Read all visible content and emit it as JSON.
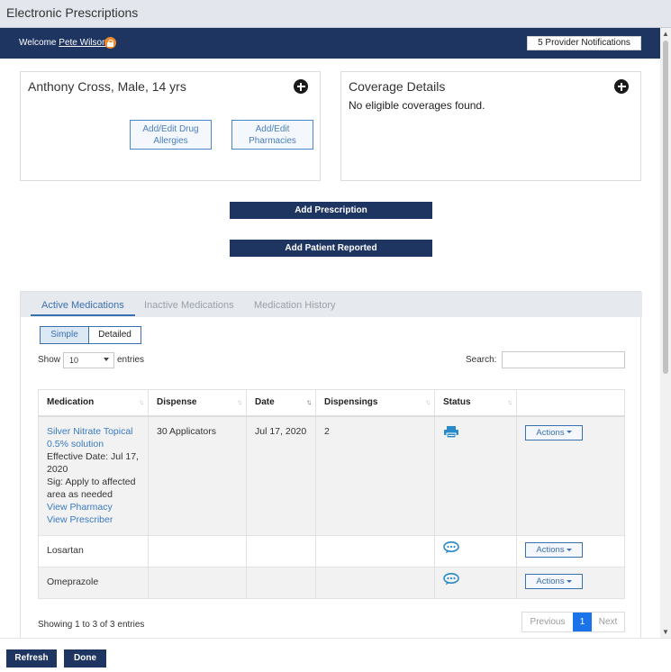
{
  "window": {
    "title": "Electronic Prescriptions"
  },
  "header": {
    "welcome_prefix": "Welcome",
    "user_name": "Pete Wilson",
    "notifications_label": "5 Provider Notifications"
  },
  "patient": {
    "summary": "Anthony Cross, Male, 14 yrs",
    "allergies_button": "Add/Edit Drug Allergies",
    "pharmacies_button": "Add/Edit Pharmacies"
  },
  "coverage": {
    "title": "Coverage Details",
    "message": "No eligible coverages found."
  },
  "actions": {
    "add_prescription": "Add Prescription",
    "add_patient_reported": "Add Patient Reported"
  },
  "tabs": [
    {
      "label": "Active Medications",
      "active": true
    },
    {
      "label": "Inactive Medications",
      "active": false
    },
    {
      "label": "Medication History",
      "active": false
    }
  ],
  "view_toggle": {
    "simple": "Simple",
    "detailed": "Detailed",
    "selected": "Simple"
  },
  "table_controls": {
    "show_label": "Show",
    "page_size": "10",
    "entries_label": "entries",
    "search_label": "Search:",
    "search_value": ""
  },
  "table": {
    "columns": [
      "Medication",
      "Dispense",
      "Date",
      "Dispensings",
      "Status",
      ""
    ],
    "sorted_column": "Date",
    "rows": [
      {
        "medication": "Silver Nitrate Topical 0.5% solution",
        "effective": "Effective Date: Jul 17, 2020",
        "sig": "Sig: Apply to affected area as needed",
        "view_pharmacy": "View Pharmacy",
        "view_prescriber": "View Prescriber",
        "dispense": "30 Applicators",
        "date": "Jul 17, 2020",
        "dispensings": "2",
        "status_icon": "printer-icon",
        "actions_label": "Actions"
      },
      {
        "medication": "Losartan",
        "dispense": "",
        "date": "",
        "dispensings": "",
        "status_icon": "chat-icon",
        "actions_label": "Actions"
      },
      {
        "medication": "Omeprazole",
        "dispense": "",
        "date": "",
        "dispensings": "",
        "status_icon": "chat-icon",
        "actions_label": "Actions"
      }
    ]
  },
  "pagination": {
    "info": "Showing 1 to 3 of 3 entries",
    "previous": "Previous",
    "current": "1",
    "next": "Next"
  },
  "footer": {
    "refresh": "Refresh",
    "done": "Done"
  },
  "colors": {
    "navy": "#1e3461",
    "accent_blue": "#3a6fb0",
    "link_blue": "#3a7ac0",
    "lock_orange": "#f08c2c",
    "status_teal": "#2a8ac8"
  }
}
